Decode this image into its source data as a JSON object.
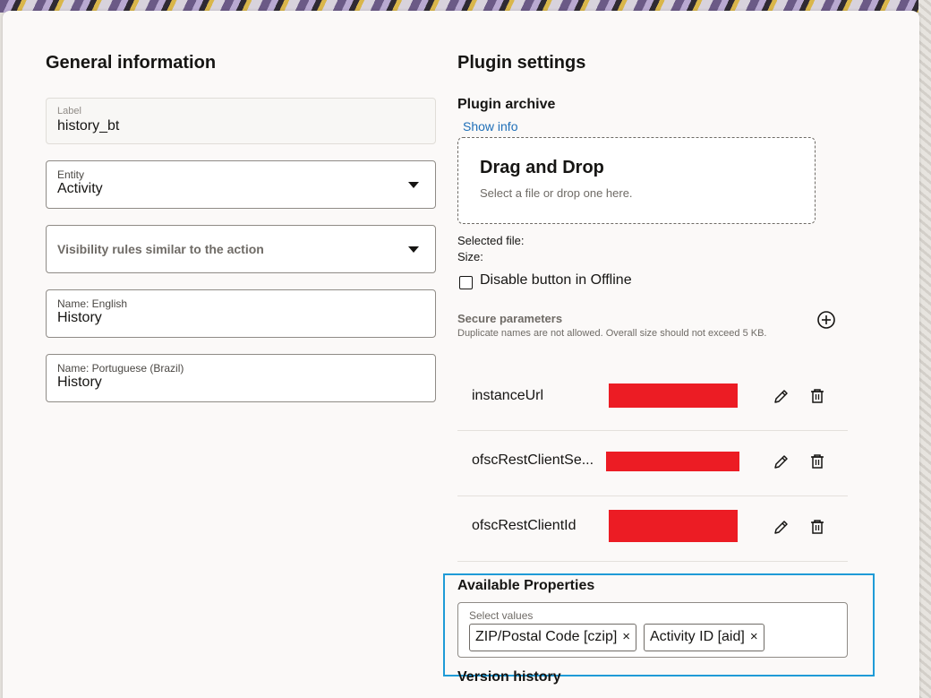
{
  "general": {
    "title": "General information",
    "label_field": {
      "label": "Label",
      "value": "history_bt"
    },
    "entity_field": {
      "label": "Entity",
      "value": "Activity"
    },
    "visibility_field": {
      "placeholder": "Visibility rules similar to the action"
    },
    "name_english": {
      "label": "Name: English",
      "value": "History"
    },
    "name_portuguese": {
      "label": "Name: Portuguese (Brazil)",
      "value": "History"
    }
  },
  "plugin": {
    "title": "Plugin settings",
    "archive_title": "Plugin archive",
    "show_info": "Show info",
    "dropzone": {
      "title": "Drag and Drop",
      "subtitle": "Select a file or drop one here."
    },
    "selected_file_label": "Selected file:",
    "size_label": "Size:",
    "disable_offline_label": "Disable button in Offline",
    "disable_offline_checked": false,
    "secure_params": {
      "title": "Secure parameters",
      "note": "Duplicate names are not allowed. Overall size should not exceed 5 KB.",
      "rows": [
        {
          "name": "instanceUrl"
        },
        {
          "name": "ofscRestClientSe..."
        },
        {
          "name": "ofscRestClientId"
        }
      ]
    },
    "available_properties": {
      "title": "Available Properties",
      "select_label": "Select values",
      "chips": [
        {
          "label": "ZIP/Postal Code [czip]",
          "remove": "×"
        },
        {
          "label": "Activity ID [aid]",
          "remove": "×"
        }
      ]
    },
    "version_history_title": "Version history"
  },
  "colors": {
    "accent_link": "#1f6fb8",
    "focus_border": "#1f9bd7",
    "redaction": "#ec1c24"
  }
}
